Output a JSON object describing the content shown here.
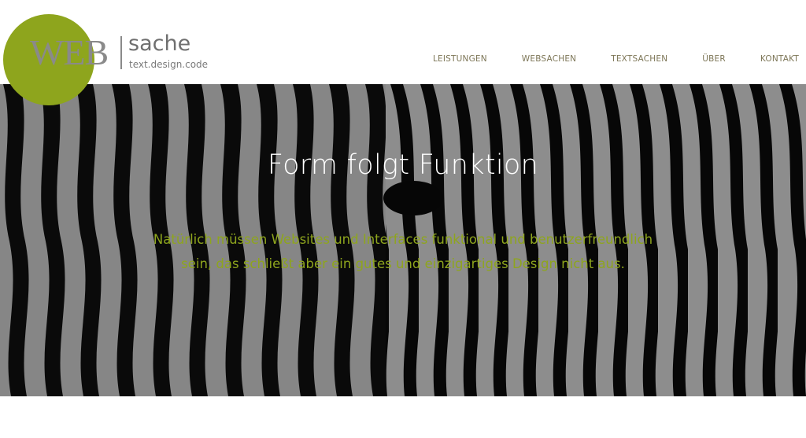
{
  "logo": {
    "mark": "WEB",
    "name": "sache",
    "tagline": "text.design.code",
    "circle_color": "#8ea51d"
  },
  "nav": {
    "items": [
      "LEISTUNGEN",
      "WEBSACHEN",
      "TEXTSACHEN",
      "ÜBER",
      "KONTAKT"
    ]
  },
  "hero": {
    "title": "Form folgt Funktion",
    "text": "Natürlich müssen Websites und Interfaces funktional und benutzerfreundlich sein, das schließt aber ein gutes und einzigartiges Design nicht aus.",
    "text_color": "#8ea51d",
    "background": "zebra-stripes-image"
  }
}
